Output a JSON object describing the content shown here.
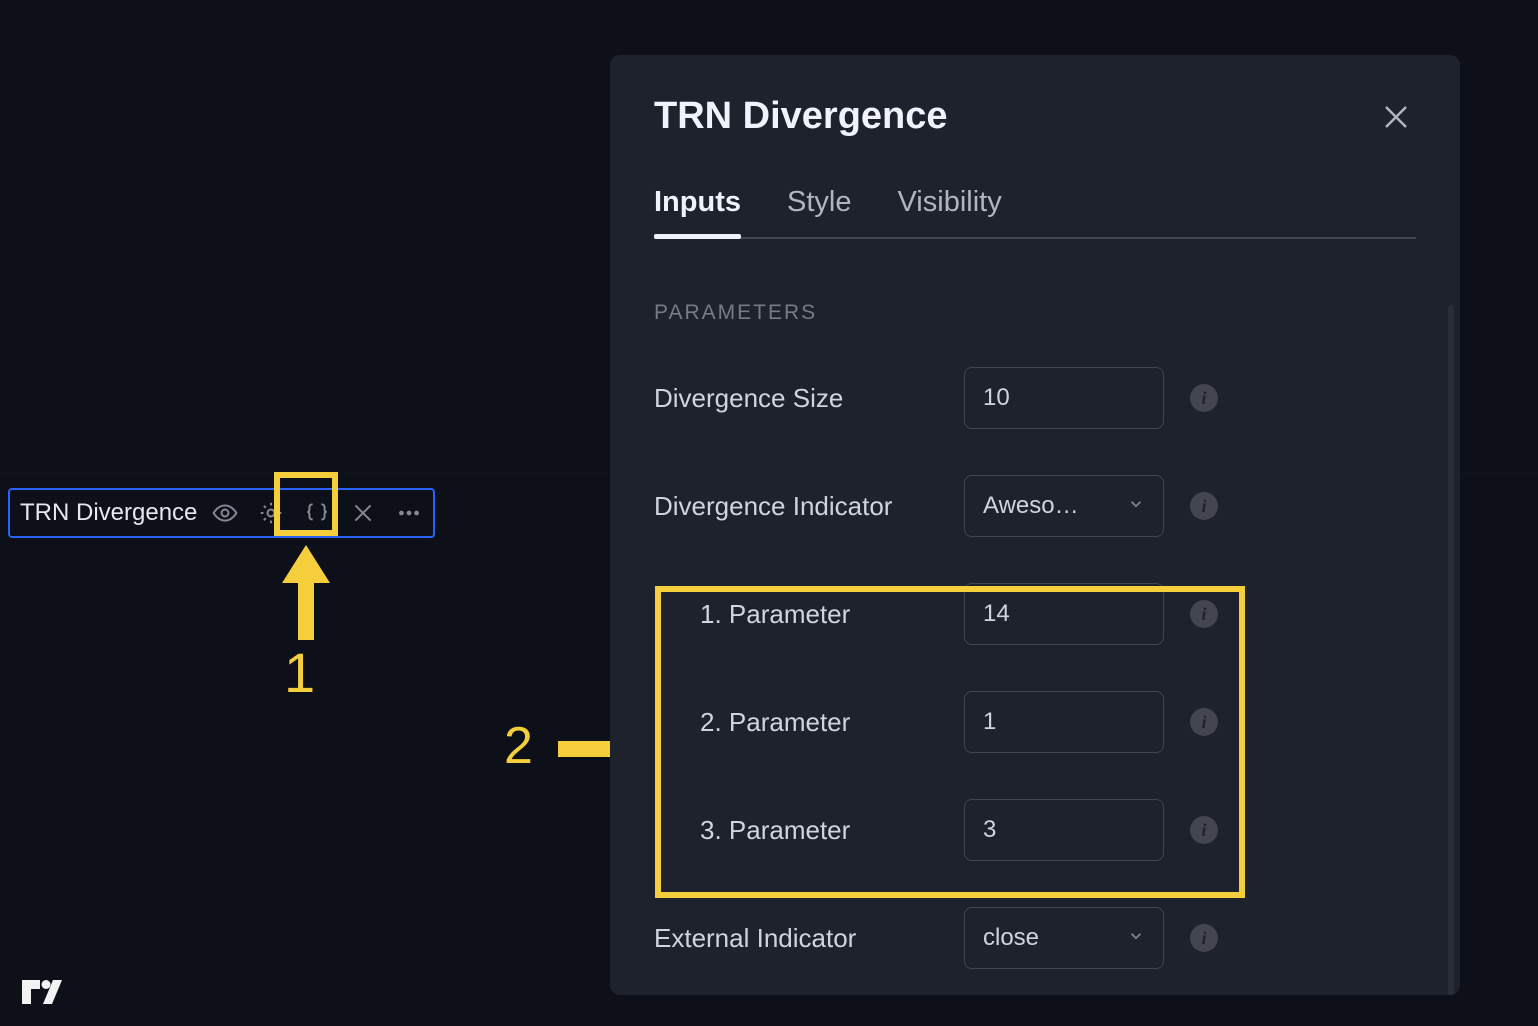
{
  "indicatorChip": {
    "name": "TRN Divergence"
  },
  "annotations": {
    "one": "1",
    "two": "2"
  },
  "dialog": {
    "title": "TRN Divergence",
    "tabs": {
      "inputs": "Inputs",
      "style": "Style",
      "visibility": "Visibility"
    },
    "sectionLabel": "PARAMETERS",
    "fields": {
      "divergenceSize": {
        "label": "Divergence Size",
        "value": "10"
      },
      "divergenceIndicator": {
        "label": "Divergence Indicator",
        "value": "Aweso…"
      },
      "param1": {
        "label": "1. Parameter",
        "value": "14"
      },
      "param2": {
        "label": "2. Parameter",
        "value": "1"
      },
      "param3": {
        "label": "3. Parameter",
        "value": "3"
      },
      "externalIndicator": {
        "label": "External Indicator",
        "value": "close"
      }
    }
  },
  "colors": {
    "highlight": "#f4cf3b",
    "chipBorder": "#2962ff"
  }
}
